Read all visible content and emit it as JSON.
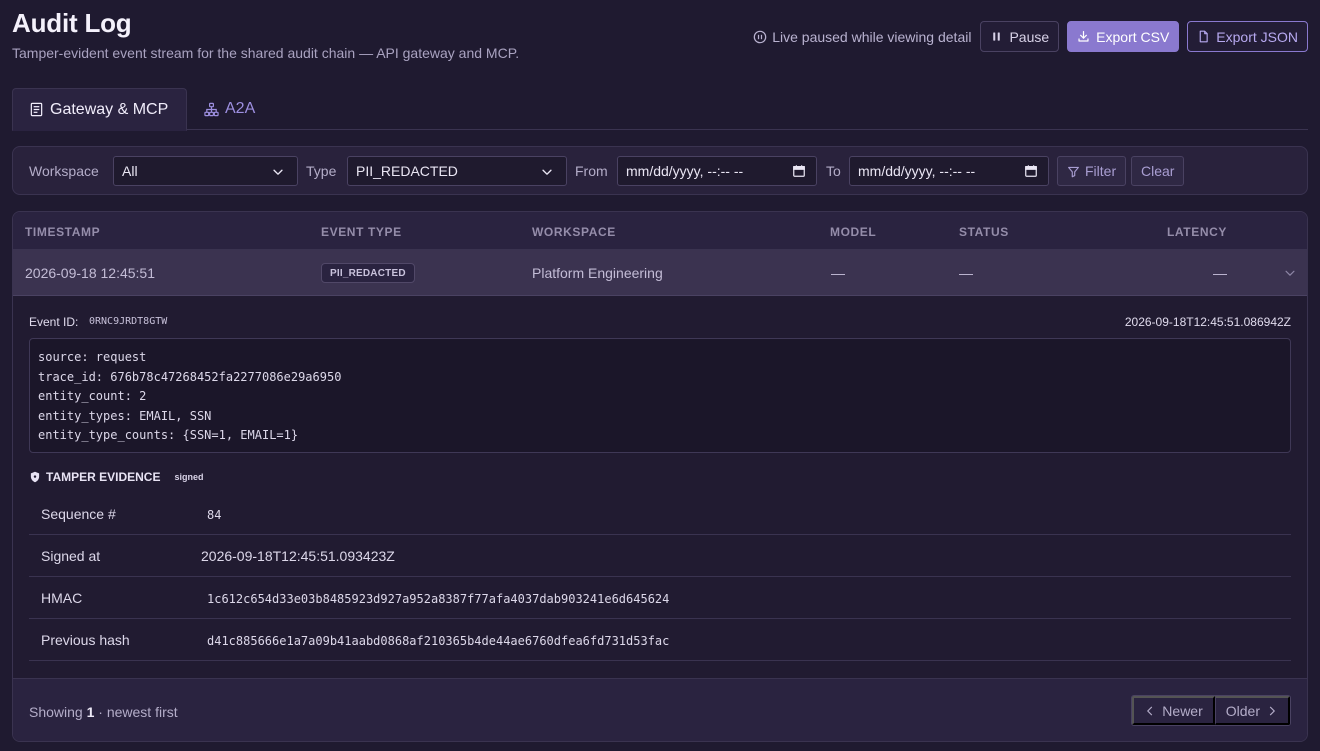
{
  "header": {
    "title": "Audit Log",
    "subtitle": "Tamper-evident event stream for the shared audit chain — API gateway and MCP.",
    "live_status": "Live paused while viewing detail",
    "pause_label": "Pause",
    "export_csv_label": "Export CSV",
    "export_json_label": "Export JSON"
  },
  "tabs": [
    {
      "label": "Gateway & MCP",
      "active": true
    },
    {
      "label": "A2A",
      "active": false
    }
  ],
  "filters": {
    "workspace_label": "Workspace",
    "workspace_value": "All",
    "type_label": "Type",
    "type_value": "PII_REDACTED",
    "from_label": "From",
    "from_placeholder": "mm/dd/yyyy, --:-- --",
    "to_label": "To",
    "to_placeholder": "mm/dd/yyyy, --:-- --",
    "filter_label": "Filter",
    "clear_label": "Clear"
  },
  "table": {
    "columns": [
      "TIMESTAMP",
      "EVENT TYPE",
      "WORKSPACE",
      "MODEL",
      "STATUS",
      "LATENCY"
    ],
    "rows": [
      {
        "timestamp": "2026-09-18 12:45:51",
        "event_type": "PII_REDACTED",
        "workspace": "Platform Engineering",
        "model": "—",
        "status": "—",
        "latency": "—"
      }
    ]
  },
  "detail": {
    "event_id_label": "Event ID:",
    "event_id": "0RNC9JRDT8GTW",
    "event_timestamp": "2026-09-18T12:45:51.086942Z",
    "payload_lines": [
      "source: request",
      "trace_id: 676b78c47268452fa2277086e29a6950",
      "entity_count: 2",
      "entity_types: EMAIL, SSN",
      "entity_type_counts: {SSN=1, EMAIL=1}"
    ],
    "tamper_title": "TAMPER EVIDENCE",
    "tamper_badge": "signed",
    "tamper_fields": [
      {
        "key": "Sequence #",
        "value": "84"
      },
      {
        "key": "Signed at",
        "value": "2026-09-18T12:45:51.093423Z"
      },
      {
        "key": "HMAC",
        "value": "1c612c654d33e03b8485923d927a952a8387f77afa4037dab903241e6d645624"
      },
      {
        "key": "Previous hash",
        "value": "d41c885666e1a7a09b41aabd0868af210365b4de44ae6760dfea6fd731d53fac"
      }
    ]
  },
  "footer": {
    "showing_prefix": "Showing",
    "showing_count": "1",
    "showing_suffix": "· newest first",
    "newer_label": "Newer",
    "older_label": "Older"
  },
  "colors": {
    "background": "#1f1a30",
    "accent": "#8a79cf",
    "accent_text": "#9d8fe0"
  },
  "icons": [
    "pause-circle-icon",
    "pause-icon",
    "download-icon",
    "file-icon",
    "list-icon",
    "network-icon",
    "chevron-down-icon",
    "calendar-icon",
    "filter-icon",
    "shield-icon",
    "chevron-left-icon",
    "chevron-right-icon"
  ]
}
